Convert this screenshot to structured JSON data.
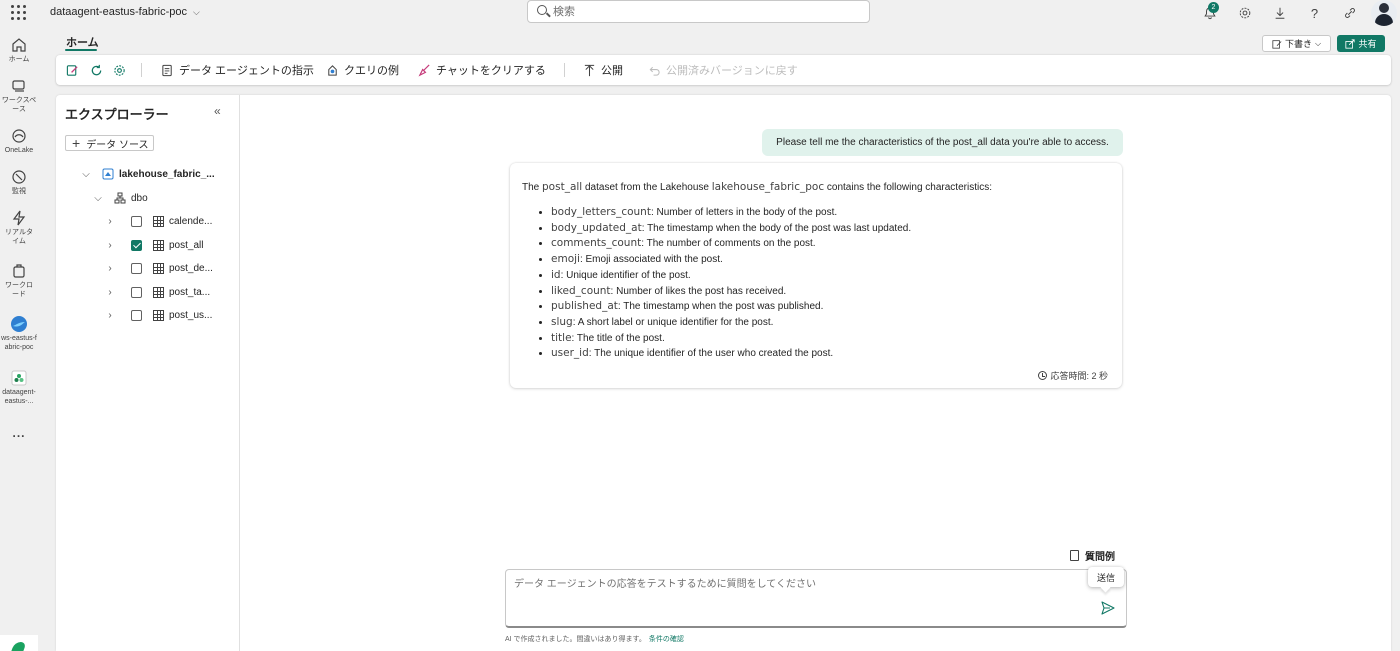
{
  "topbar": {
    "workspace_title": "dataagent-eastus-fabric-poc",
    "search_placeholder": "検索",
    "notification_count": "2"
  },
  "rail": {
    "items": [
      {
        "label": "ホーム",
        "icon": "home-icon"
      },
      {
        "label": "ワークスペース",
        "icon": "workspaces-icon"
      },
      {
        "label": "OneLake",
        "icon": "onelake-icon"
      },
      {
        "label": "監視",
        "icon": "monitor-icon"
      },
      {
        "label": "リアルタイム",
        "icon": "realtime-icon"
      },
      {
        "label": "ワークロード",
        "icon": "workload-icon"
      },
      {
        "label": "ws-eastus-fabric-poc",
        "icon": "workspace-logo-icon"
      },
      {
        "label": "dataagent-eastus-...",
        "icon": "data-agent-icon"
      }
    ],
    "more": "..."
  },
  "header": {
    "home_tab": "ホーム",
    "draft_label": "下書き",
    "share_label": "共有"
  },
  "toolbar": {
    "instructions": "データ エージェントの指示",
    "query_examples": "クエリの例",
    "clear_chat": "チャットをクリアする",
    "publish": "公開",
    "revert": "公開済みバージョンに戻す"
  },
  "explorer": {
    "title": "エクスプローラー",
    "add_source": "データ ソース",
    "lakehouse": "lakehouse_fabric_...",
    "schema": "dbo",
    "tables": [
      {
        "name": "calende...",
        "checked": false
      },
      {
        "name": "post_all",
        "checked": true
      },
      {
        "name": "post_de...",
        "checked": false
      },
      {
        "name": "post_ta...",
        "checked": false
      },
      {
        "name": "post_us...",
        "checked": false
      }
    ]
  },
  "chat": {
    "user_message": "Please tell me the characteristics of the post_all data you're able to access.",
    "intro_pre": "The ",
    "intro_dataset": "post_all",
    "intro_mid": " dataset from the Lakehouse ",
    "intro_lakehouse": "lakehouse_fabric_poc",
    "intro_post": " contains the following characteristics:",
    "fields": [
      {
        "name": "body_letters_count",
        "desc": ": Number of letters in the body of the post."
      },
      {
        "name": "body_updated_at",
        "desc": ": The timestamp when the body of the post was last updated."
      },
      {
        "name": "comments_count",
        "desc": ": The number of comments on the post."
      },
      {
        "name": "emoji",
        "desc": ": Emoji associated with the post."
      },
      {
        "name": "id",
        "desc": ": Unique identifier of the post."
      },
      {
        "name": "liked_count",
        "desc": ": Number of likes the post has received."
      },
      {
        "name": "published_at",
        "desc": ": The timestamp when the post was published."
      },
      {
        "name": "slug",
        "desc": ": A short label or unique identifier for the post."
      },
      {
        "name": "title",
        "desc": ": The title of the post."
      },
      {
        "name": "user_id",
        "desc": ": The unique identifier of the user who created the post."
      }
    ],
    "response_time": "応答時間: 2 秒",
    "question_examples": "質問例",
    "input_placeholder": "データ エージェントの応答をテストするために質問をしてください",
    "send_tooltip": "送信",
    "disclaimer": "AI で作成されました。間違いはあり得ます。",
    "terms_link": "条件の確認"
  },
  "colors": {
    "accent": "#117865",
    "user_bubble": "#e0f2ec"
  }
}
